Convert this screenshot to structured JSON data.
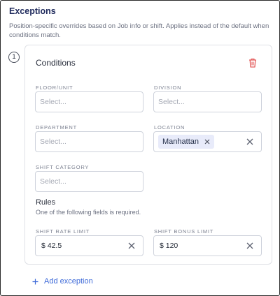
{
  "section": {
    "title": "Exceptions",
    "description": "Position-specific overrides based on Job info or shift. Applies instead of the default when conditions match."
  },
  "exception": {
    "number": "1",
    "conditions_title": "Conditions",
    "fields": {
      "floor_unit": {
        "label": "FLOOR/UNIT",
        "placeholder": "Select..."
      },
      "division": {
        "label": "DIVISION",
        "placeholder": "Select..."
      },
      "department": {
        "label": "DEPARTMENT",
        "placeholder": "Select..."
      },
      "location": {
        "label": "LOCATION",
        "chip": "Manhattan"
      },
      "shift_category": {
        "label": "SHIFT CATEGORY",
        "placeholder": "Select..."
      }
    },
    "rules": {
      "title": "Rules",
      "description": "One of the following fields is required.",
      "shift_rate_limit": {
        "label": "SHIFT RATE LIMIT",
        "value": "$ 42.5"
      },
      "shift_bonus_limit": {
        "label": "SHIFT BONUS LIMIT",
        "value": "$ 120"
      }
    }
  },
  "actions": {
    "add_exception": "Add exception"
  },
  "icons": {
    "trash": "trash-icon",
    "clear": "close-icon",
    "add": "plus-icon"
  },
  "colors": {
    "accent": "#3e6ad8",
    "danger": "#e35d5d",
    "chip_bg": "#e8ebfa",
    "title": "#1f2a5c"
  }
}
